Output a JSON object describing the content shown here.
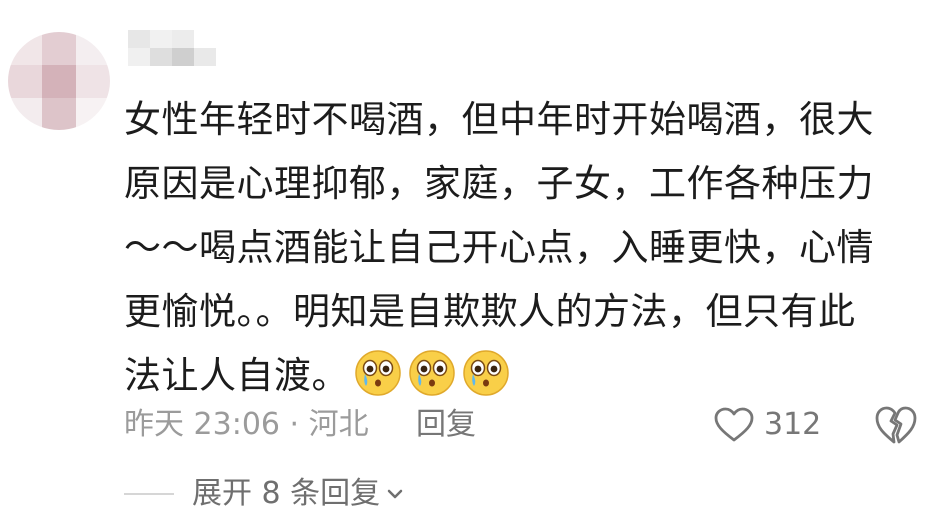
{
  "comment": {
    "author": {
      "avatar": "blurred-avatar",
      "name_hidden": true
    },
    "lines": [
      "女性年轻时不喝酒，但中年时开始喝酒，很大",
      "原因是心理抑郁，家庭，子女，工作各种压力",
      "～～喝点酒能让自己开心点，入睡更快，心情",
      "更愉悦。。明知是自欺欺人的方法，但只有此",
      "法让人自渡。"
    ],
    "emojis": [
      "crying-face-emoji",
      "crying-face-emoji",
      "crying-face-emoji"
    ],
    "time_location": "昨天 23:06 · 河北",
    "reply_label": "回复",
    "like_count": "312",
    "expand_label": "展开 8 条回复"
  },
  "colors": {
    "text": "#1c1c1c",
    "meta": "#9b9b9b",
    "icon": "#777777"
  }
}
